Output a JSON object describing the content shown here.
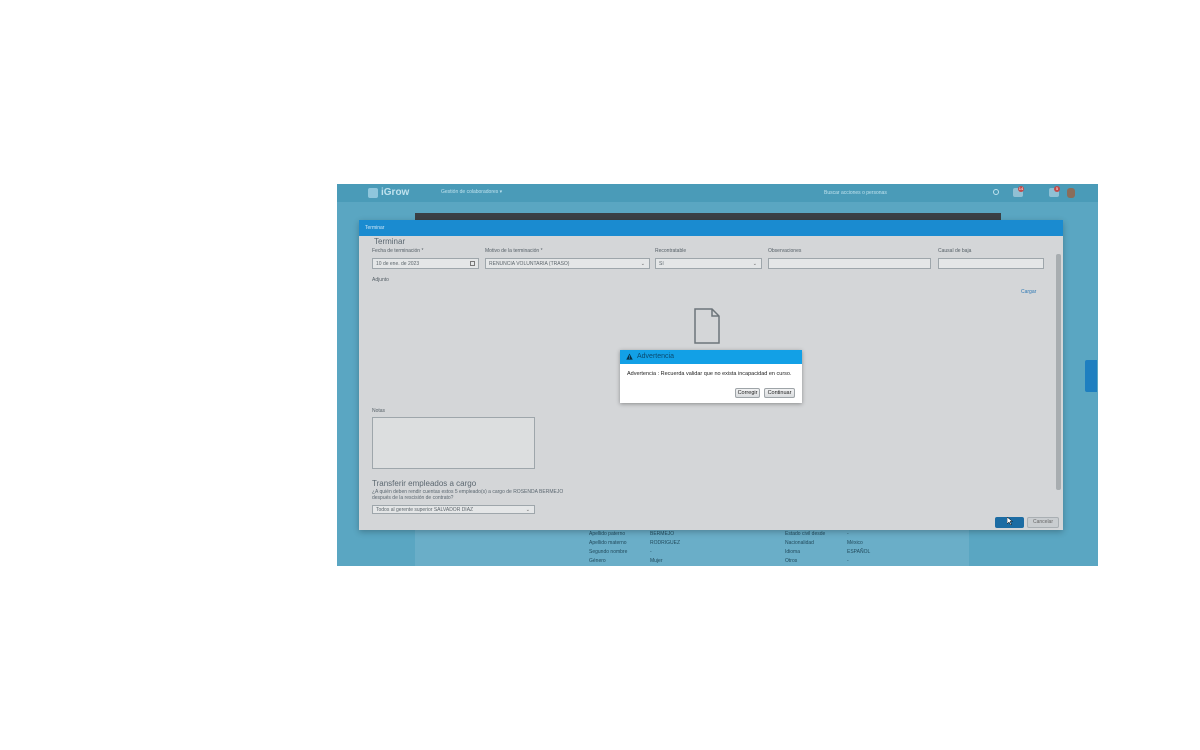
{
  "app": {
    "logo_text": "iGrow",
    "nav_menu": "Gestión de colaboradores ▾",
    "search_placeholder": "Buscar acciones o personas",
    "notifications": [
      "14",
      "5"
    ]
  },
  "dialog": {
    "title": "Terminar",
    "section_title": "Terminar",
    "fields": {
      "termination_date_label": "Fecha de terminación *",
      "termination_date_value": "10 de ene. de 2023",
      "reason_label": "Motivo de la terminación *",
      "reason_value": "RENUNCIA VOLUNTARIA (TRASO)",
      "rehireable_label": "Recontratable",
      "rehireable_value": "Sí",
      "observations_label": "Observaciones",
      "observations_value": "",
      "cause_label": "Causal de baja",
      "cause_value": ""
    },
    "attachment_label": "Adjunto",
    "upload_link": "Cargar",
    "notes_label": "Notas",
    "transfer_title": "Transferir empleados a cargo",
    "transfer_question": "¿A quién deben rendir cuentas estos 5 empleado(s) a cargo de ROSENDA BERMEJO después de la rescisión de contrato?",
    "transfer_value": "Todos al gerente superior SALVADOR DIAZ",
    "accept_label": "",
    "cancel_label": "Cancelar"
  },
  "background": {
    "rows": [
      {
        "l1": "Apellido paterno",
        "v1": "BERMEJO",
        "l2": "Estado civil desde",
        "v2": "-"
      },
      {
        "l1": "Apellido materno",
        "v1": "RODRIGUEZ",
        "l2": "Nacionalidad",
        "v2": "México"
      },
      {
        "l1": "Segundo nombre",
        "v1": "-",
        "l2": "Idioma",
        "v2": "ESPAÑOL"
      },
      {
        "l1": "Género",
        "v1": "Mujer",
        "l2": "Otros",
        "v2": "-"
      }
    ]
  },
  "alert": {
    "title": "Advertencia",
    "message": "Advertencia : Recuerda validar que no exista incapacidad en curso.",
    "correct_button": "Corregir",
    "continue_button": "Continuar"
  },
  "colors": {
    "header_blue": "#12a0e6",
    "dialog_titlebar": "#1a8bd0",
    "accept_button": "#1c6ca3"
  }
}
